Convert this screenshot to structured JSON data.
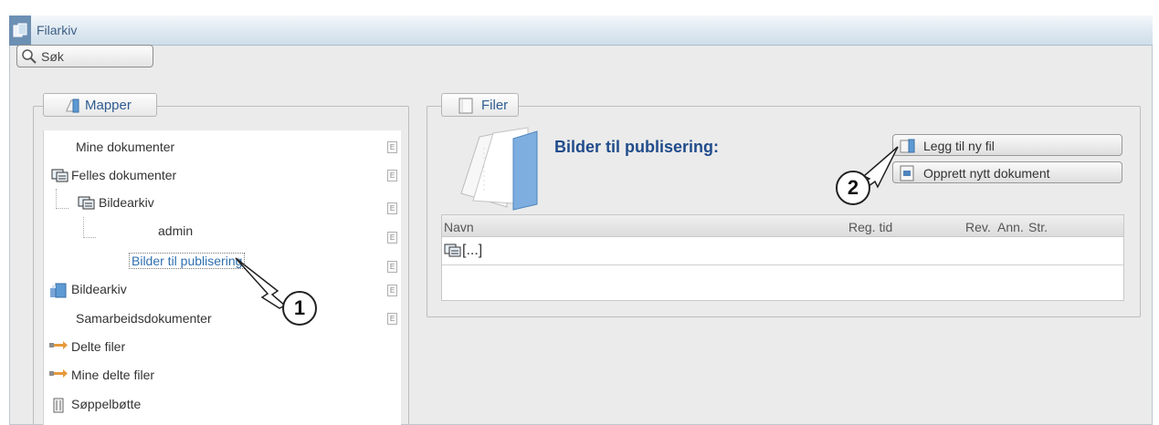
{
  "window": {
    "title": "Filarkiv"
  },
  "search": {
    "label": "Søk"
  },
  "mapper": {
    "legend": "Mapper",
    "items": [
      {
        "label": "Mine dokumenter",
        "icon": "none"
      },
      {
        "label": "Felles dokumenter",
        "icon": "shared-folder-icon"
      },
      {
        "label": "Bildearkiv",
        "icon": "shared-folder-icon"
      },
      {
        "label": "admin",
        "icon": "none"
      },
      {
        "label": "Bilder til publisering",
        "icon": "none",
        "selected": true
      },
      {
        "label": "Bildearkiv",
        "icon": "image-archive-icon"
      },
      {
        "label": "Samarbeidsdokumenter",
        "icon": "none"
      },
      {
        "label": "Delte filer",
        "icon": "shared-arrow-icon"
      },
      {
        "label": "Mine delte filer",
        "icon": "shared-arrow-icon"
      },
      {
        "label": "Søppelbøtte",
        "icon": "trash-icon"
      }
    ],
    "e_label": "E"
  },
  "filer": {
    "legend": "Filer",
    "heading": "Bilder til publisering:",
    "buttons": {
      "add_file": "Legg til ny fil",
      "create_doc": "Opprett nytt dokument"
    },
    "columns": [
      "Navn",
      "Reg. tid",
      "Rev.",
      "Ann.",
      "Str."
    ],
    "rows": [
      {
        "name": "[...]",
        "icon": "shared-folder-icon"
      }
    ]
  },
  "callouts": [
    "1",
    "2"
  ],
  "colors": {
    "accent": "#2f5c91",
    "heading": "#214c8b",
    "selected": "#2f6fb0"
  }
}
